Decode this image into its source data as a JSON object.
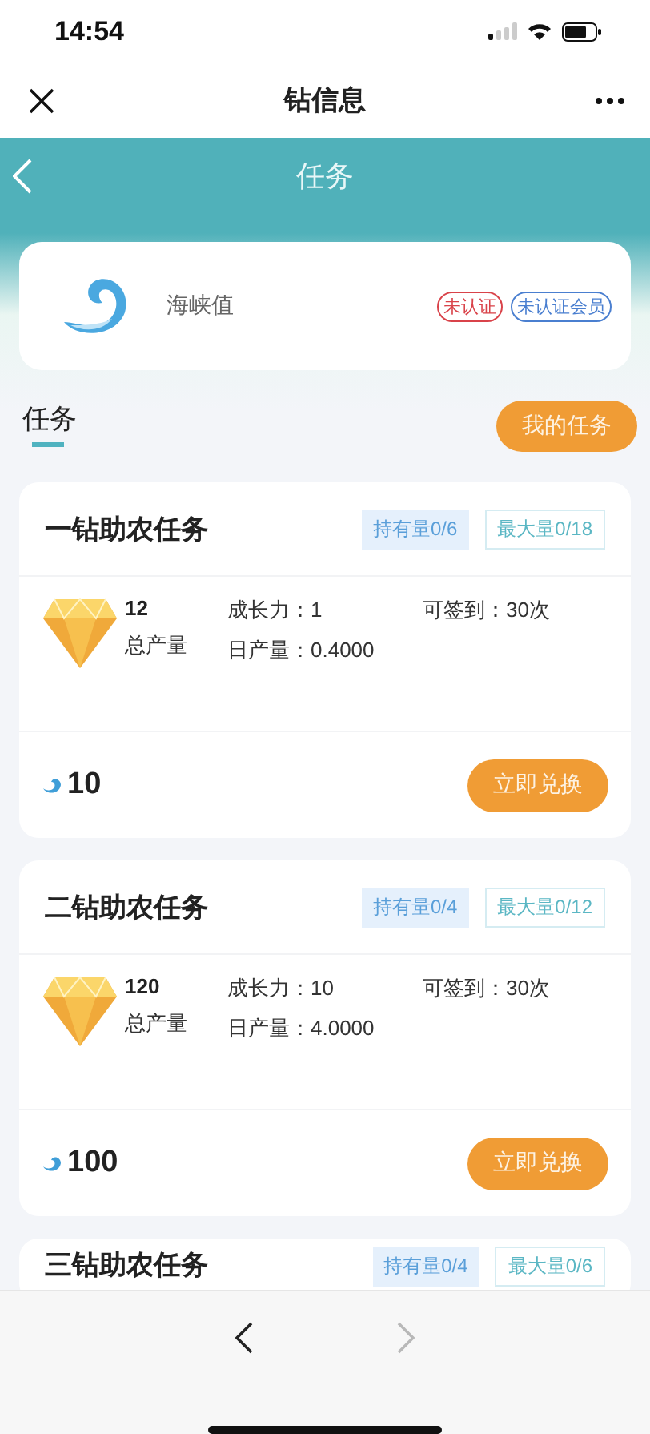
{
  "status_bar": {
    "time": "14:54"
  },
  "nav_bar": {
    "title": "钻信息"
  },
  "header": {
    "title": "任务"
  },
  "profile": {
    "name": "海峡值",
    "tags": [
      {
        "label": "未认证",
        "color": "#d9434a"
      },
      {
        "label": "未认证会员",
        "color": "#4a7fd0"
      }
    ]
  },
  "section": {
    "tab": {
      "label": "任务",
      "selected": true
    },
    "button": "我的任务"
  },
  "tasks": [
    {
      "title": "一钻助农任务",
      "held": "持有量0/6",
      "max": "最大量0/18",
      "total": "12",
      "total_label": "总产量",
      "growth": "成长力：1",
      "daily": "日产量：0.4000",
      "checkin": "可签到：30次",
      "price": "10",
      "button": "立即兑换"
    },
    {
      "title": "二钻助农任务",
      "held": "持有量0/4",
      "max": "最大量0/12",
      "total": "120",
      "total_label": "总产量",
      "growth": "成长力：10",
      "daily": "日产量：4.0000",
      "checkin": "可签到：30次",
      "price": "100",
      "button": "立即兑换"
    },
    {
      "title": "三钻助农任务",
      "held": "持有量0/4",
      "max": "最大量0/6"
    }
  ],
  "browser_nav": [
    {
      "kind": "back",
      "disabled": false
    },
    {
      "kind": "forward",
      "disabled": true
    }
  ]
}
